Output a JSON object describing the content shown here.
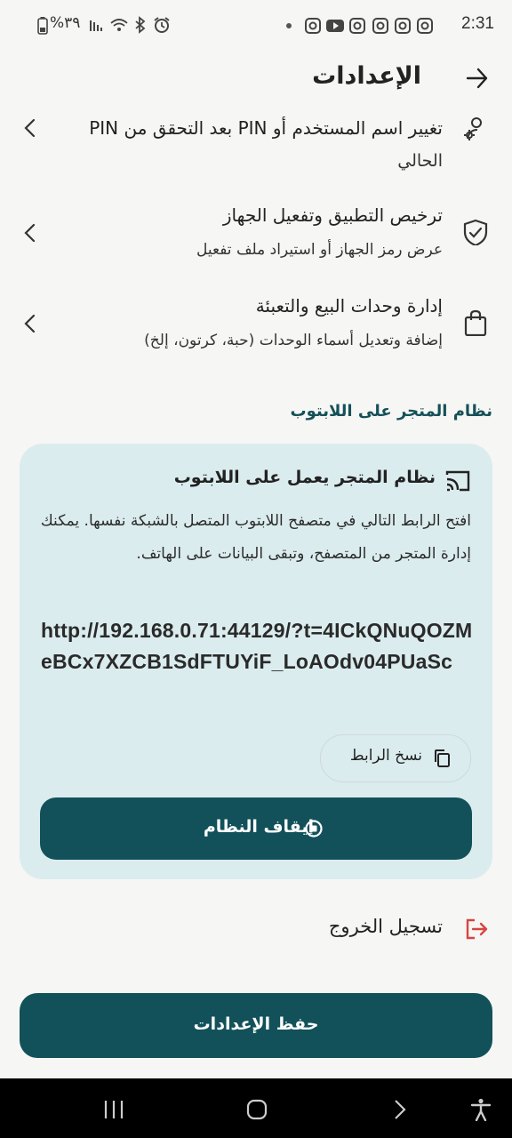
{
  "status_bar": {
    "time": "2:31",
    "battery_text": "%٣٩",
    "icons": [
      "battery-icon",
      "signal-icon",
      "wifi-icon",
      "bluetooth-icon",
      "alarm-icon",
      "dot-icon",
      "instagram-icon",
      "youtube-icon",
      "instagram-icon",
      "instagram-icon",
      "instagram-icon",
      "instagram-icon"
    ]
  },
  "header": {
    "title": "الإعدادات",
    "back_icon": "arrow-right-icon"
  },
  "settings": [
    {
      "title": "تغيير اسم المستخدم أو PIN بعد التحقق من PIN",
      "subtitle": "الحالي",
      "icon": "user-gear-icon"
    },
    {
      "title": "ترخيص التطبيق وتفعيل الجهاز",
      "subtitle": "عرض رمز الجهاز أو استيراد ملف تفعيل",
      "icon": "shield-check-icon"
    },
    {
      "title": "إدارة وحدات البيع والتعبئة",
      "subtitle": "إضافة وتعديل أسماء الوحدات (حبة، كرتون، إلخ)",
      "icon": "shopping-bag-icon"
    }
  ],
  "laptop_section": {
    "section_title": "نظام المتجر على اللابتوب",
    "card_title": "نظام المتجر يعمل على اللابتوب",
    "description": "افتح الرابط التالي في متصفح اللابتوب المتصل بالشبكة نفسها. يمكنك إدارة المتجر من المتصفح، وتبقى البيانات على الهاتف.",
    "url": "http://192.168.0.71:44129/?t=4ICkQNuQOZMeBCx7XZCB1SdFTUYiF_LoAOdv04PUaSc",
    "copy_label": "نسخ الرابط",
    "stop_label": "إيقاف النظام"
  },
  "logout_label": "تسجيل الخروج",
  "save_label": "حفظ الإعدادات",
  "colors": {
    "primary": "#12515a",
    "card_bg": "#dbecee",
    "logout_red": "#d64541",
    "background": "#f6f6f4"
  }
}
